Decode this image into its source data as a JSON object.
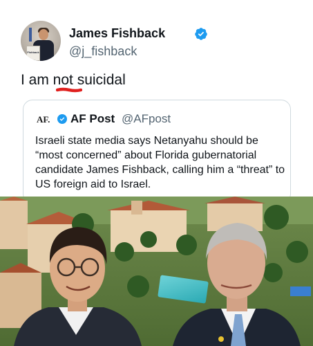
{
  "tweet": {
    "author_name": "James Fishback",
    "author_handle": "@j_fishback",
    "text": "I am not suicidal",
    "avatar_podium_text": "Fishback"
  },
  "quote": {
    "logo_text": "AF.",
    "author_name": "AF Post",
    "author_handle": "@AFpost",
    "body": "Israeli state media says Netanyahu should be “most concerned” about Florida gubernatorial candidate James Fishback, calling him a “threat” to US foreign aid to Israel."
  },
  "icons": {
    "verified": "verified-badge-icon"
  },
  "colors": {
    "verified_blue": "#1d9bf0",
    "underline_red": "#e0201e",
    "handle_gray": "#536471",
    "border": "#cfd9de"
  }
}
